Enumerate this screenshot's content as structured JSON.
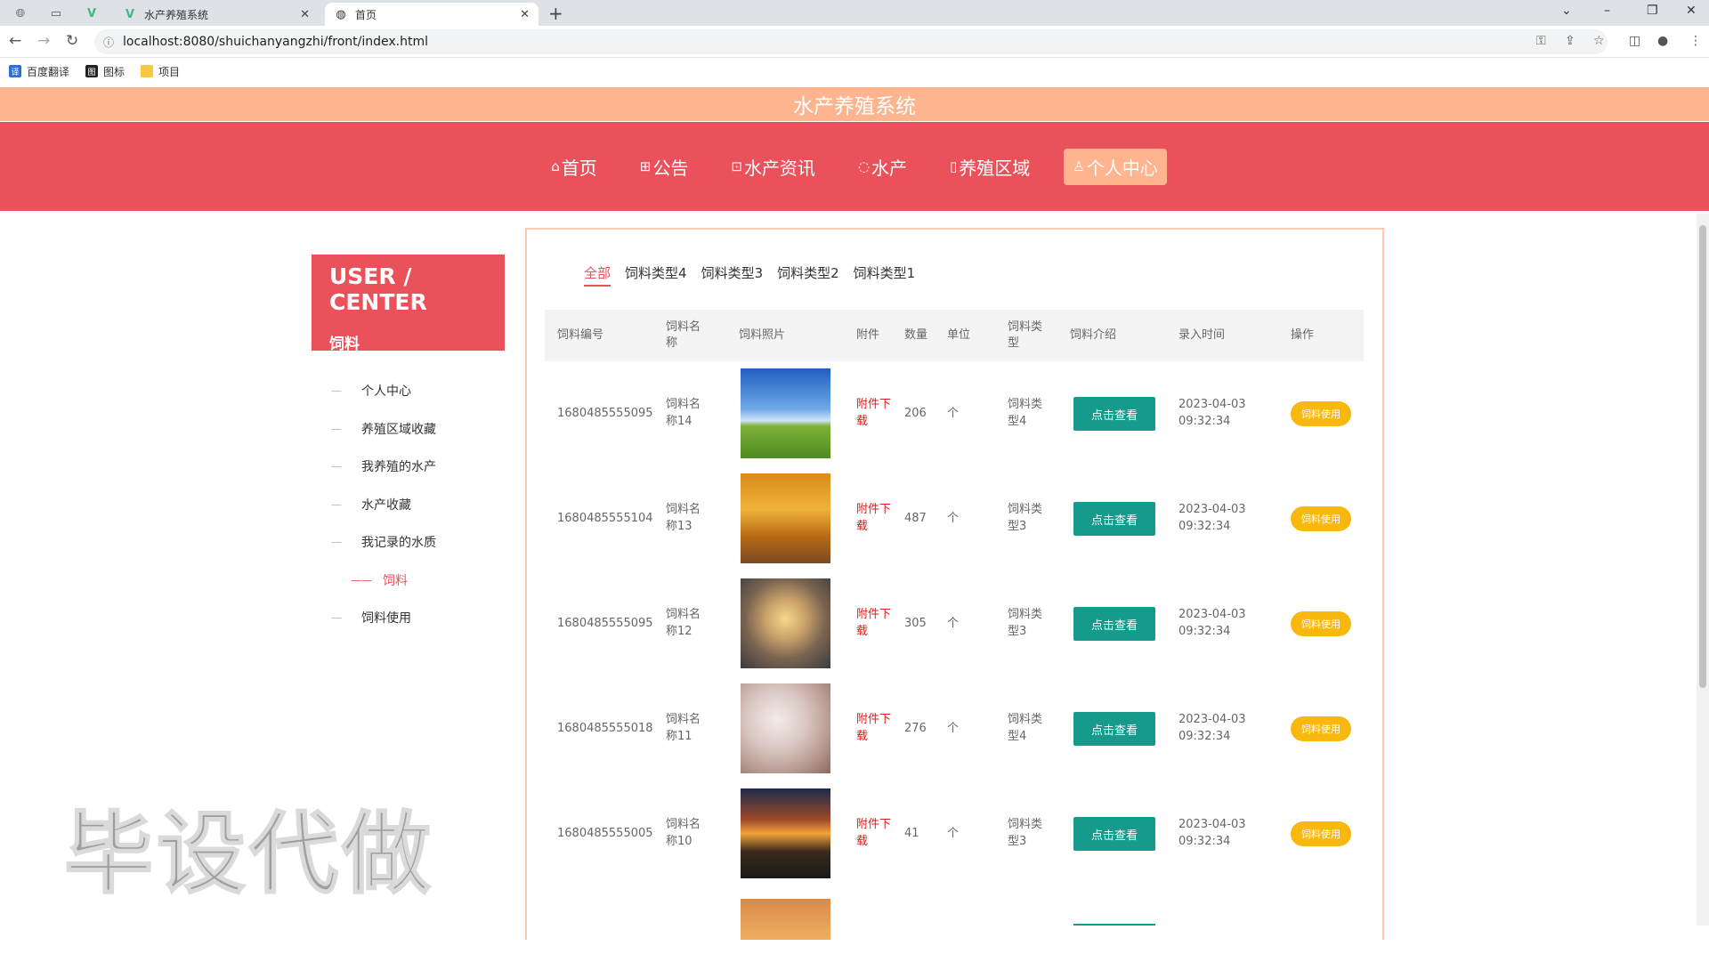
{
  "browser": {
    "tabs": [
      {
        "title": "水产养殖系统",
        "icon": "vue-logo-icon"
      },
      {
        "title": "首页",
        "icon": "globe-icon"
      }
    ],
    "url": "localhost:8080/shuichanyangzhi/front/index.html",
    "bookmarks": [
      {
        "label": "百度翻译",
        "color": "#2a6fdb",
        "glyph": "译"
      },
      {
        "label": "图标",
        "color": "#222222",
        "glyph": "图"
      },
      {
        "label": "项目",
        "color": "#f5c842",
        "glyph": ""
      }
    ]
  },
  "site": {
    "title": "水产养殖系统",
    "nav": [
      {
        "label": "首页",
        "icon": "⌂"
      },
      {
        "label": "公告",
        "icon": "⊞"
      },
      {
        "label": "水产资讯",
        "icon": "⊡"
      },
      {
        "label": "水产",
        "icon": "◌"
      },
      {
        "label": "养殖区域",
        "icon": "▯"
      },
      {
        "label": "个人中心",
        "icon": "♙"
      }
    ],
    "colors": {
      "primary": "#e9525a",
      "accent": "#fdb48f",
      "view_button": "#159a8c",
      "use_button": "#f9b80d"
    }
  },
  "sidebar": {
    "heading": "USER / CENTER",
    "subheading": "饲料",
    "items": [
      "个人中心",
      "养殖区域收藏",
      "我养殖的水产",
      "水产收藏",
      "我记录的水质",
      "饲料",
      "饲料使用"
    ],
    "active_index": 5
  },
  "filters": {
    "items": [
      "全部",
      "饲料类型4",
      "饲料类型3",
      "饲料类型2",
      "饲料类型1"
    ],
    "active_index": 0
  },
  "table": {
    "headers": [
      "饲料编号",
      "饲料名称",
      "饲料照片",
      "附件",
      "数量",
      "单位",
      "饲料类型",
      "饲料介绍",
      "录入时间",
      "操作"
    ],
    "rows": [
      {
        "code": "1680485555095",
        "name": "饲料名称14",
        "photo": "meadow-sky",
        "attach": "附件下载",
        "qty": "206",
        "unit": "个",
        "type": "饲料类型4",
        "intro": "点击查看",
        "time": "2023-04-03 09:32:34",
        "op": "饲料使用"
      },
      {
        "code": "1680485555104",
        "name": "饲料名称13",
        "photo": "autumn-trees",
        "attach": "附件下载",
        "qty": "487",
        "unit": "个",
        "type": "饲料类型3",
        "intro": "点击查看",
        "time": "2023-04-03 09:32:34",
        "op": "饲料使用"
      },
      {
        "code": "1680485555095",
        "name": "饲料名称12",
        "photo": "fisheye-sunset",
        "attach": "附件下载",
        "qty": "305",
        "unit": "个",
        "type": "饲料类型3",
        "intro": "点击查看",
        "time": "2023-04-03 09:32:34",
        "op": "饲料使用"
      },
      {
        "code": "1680485555018",
        "name": "饲料名称11",
        "photo": "blossom-branch",
        "attach": "附件下载",
        "qty": "276",
        "unit": "个",
        "type": "饲料类型4",
        "intro": "点击查看",
        "time": "2023-04-03 09:32:34",
        "op": "饲料使用"
      },
      {
        "code": "1680485555005",
        "name": "饲料名称10",
        "photo": "road-sunset",
        "attach": "附件下载",
        "qty": "41",
        "unit": "个",
        "type": "饲料类型3",
        "intro": "点击查看",
        "time": "2023-04-03 09:32:34",
        "op": "饲料使用"
      }
    ]
  },
  "watermark": "毕设代做"
}
